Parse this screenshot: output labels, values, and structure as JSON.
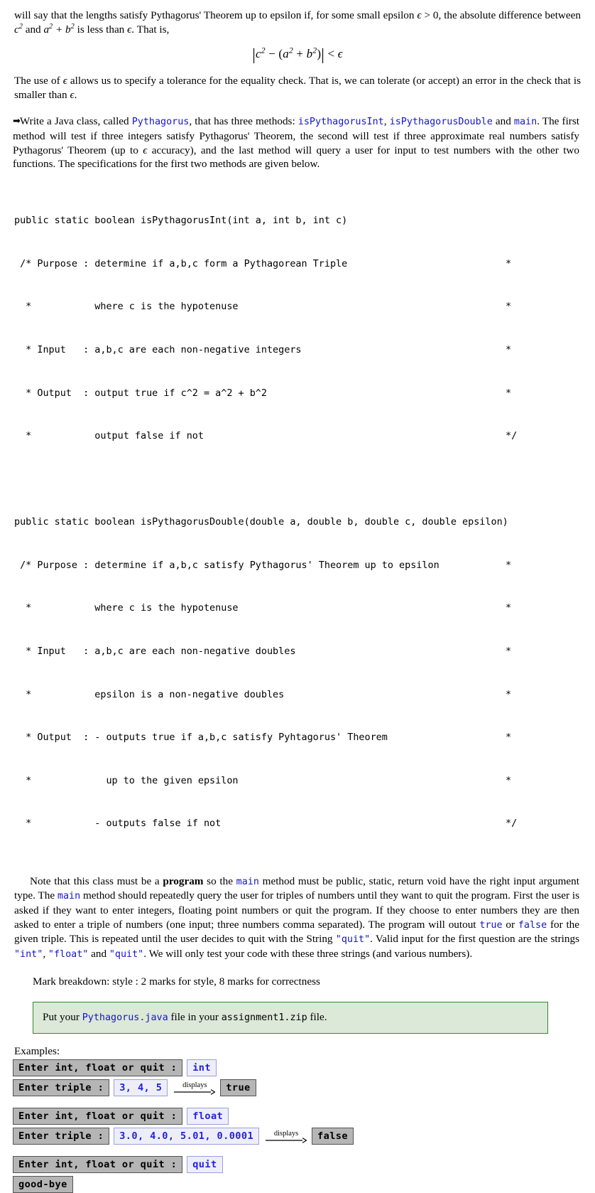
{
  "intro": {
    "para1_a": "will say that the lengths satisfy Pythagorus' Theorem ",
    "para1_em": "up to epsilon",
    "para1_b": " if, for some small epsilon ",
    "para1_eps_gt": " > 0, the absolute difference between ",
    "para1_c": " and ",
    "para1_d": " is less than ",
    "para1_e": ". That is,",
    "formula": "|c² − (a² + b²)| < ε",
    "formula_parts": {
      "bar_open": "|",
      "c": "c",
      "sup2_1": "2",
      "minus": "−",
      "paren_open": "(",
      "a": "a",
      "sup2_2": "2",
      "plus": "+",
      "b": "b",
      "sup2_3": "2",
      "paren_close": ")",
      "bar_close": "|",
      "lt": "<",
      "eps": "ε"
    },
    "para2_a": "The use of ",
    "para2_b": " allows us to specify a tolerance for the equality check. That is, we can tolerate (or accept) an error in the check that is smaller than ",
    "para2_c": "."
  },
  "task": {
    "bullet": "➡",
    "t1": "Write a Java class, called ",
    "class_name": "Pythagorus",
    "t2": ", that has three methods: ",
    "m1": "isPythagorusInt",
    "t3": ", ",
    "m2": "isPythagorusDouble",
    "t4": " and ",
    "m3": "main",
    "t5": ". The first method will test if three integers satisfy Pythagorus' Theorem, the second will test if three approximate real numbers satisfy Pythagorus' Theorem (up to ",
    "t6": " accuracy), and the last method will query a user for input to test numbers with the other two functions. The specifications for the first two methods are given below."
  },
  "spec_int": {
    "signature": "public static boolean isPythagorusInt(int a, int b, int c)",
    "lines": [
      {
        "text": " /* Purpose : determine if a,b,c form a Pythagorean Triple",
        "star": "*"
      },
      {
        "text": "  *           where c is the hypotenuse",
        "star": "*"
      },
      {
        "text": "  * Input   : a,b,c are each non-negative integers",
        "star": "*"
      },
      {
        "text": "  * Output  : output true if c^2 = a^2 + b^2",
        "star": "*"
      },
      {
        "text": "  *           output false if not",
        "star": "*/"
      }
    ]
  },
  "spec_double": {
    "signature": "public static boolean isPythagorusDouble(double a, double b, double c, double epsilon)",
    "lines": [
      {
        "text": " /* Purpose : determine if a,b,c satisfy Pythagorus' Theorem up to epsilon",
        "star": "*"
      },
      {
        "text": "  *           where c is the hypotenuse",
        "star": "*"
      },
      {
        "text": "  * Input   : a,b,c are each non-negative doubles",
        "star": "*"
      },
      {
        "text": "  *           epsilon is a non-negative doubles",
        "star": "*"
      },
      {
        "text": "  * Output  : - outputs true if a,b,c satisfy Pyhtagorus' Theorem",
        "star": "*"
      },
      {
        "text": "  *             up to the given epsilon",
        "star": "*"
      },
      {
        "text": "  *           - outputs false if not",
        "star": "*/"
      }
    ]
  },
  "note": {
    "n1": "Note that this class must be a ",
    "program": "program",
    "n2": " so the ",
    "main1": "main",
    "n3": " method must be public, static, return void have the right input argument type. The ",
    "main2": "main",
    "n4": " method should repeatedly query the user for triples of numbers until they want to quit the program. First the user is asked if they want to enter integers, floating point numbers or quit the program. If they choose to enter numbers they are then asked to enter a triple of numbers (one input; three numbers comma separated). The program will outout ",
    "true_kw": "true",
    "n5": " or ",
    "false_kw": "false",
    "n6": " for the given triple. This is repeated until the user decides to quit with the String ",
    "quit_str": "\"quit\"",
    "n7": ". Valid input for the first question are the strings ",
    "int_str": "\"int\"",
    "n8": ", ",
    "float_str": "\"float\"",
    "n9": " and ",
    "quit_str2": "\"quit\"",
    "n10": ". We will only test your code with these three strings (and various numbers)."
  },
  "marks": {
    "text": "Mark breakdown: style : 2 marks for style, 8 marks for correctness"
  },
  "submission": {
    "pre": "Put your ",
    "file": "Pythagorus.java",
    "mid": " file in your ",
    "zip": "assignment1.zip",
    "post": " file."
  },
  "examples": {
    "label": "Examples:",
    "displays_label": "displays",
    "groups": [
      {
        "rows": [
          {
            "prompt": "Enter int, float or quit :",
            "input": "int",
            "arrow": false,
            "output": null
          },
          {
            "prompt": "Enter triple :",
            "input": "3, 4, 5",
            "arrow": true,
            "output": "true"
          }
        ]
      },
      {
        "rows": [
          {
            "prompt": "Enter int, float or quit :",
            "input": "float",
            "arrow": false,
            "output": null
          },
          {
            "prompt": "Enter triple :",
            "input": "3.0, 4.0, 5.01, 0.0001",
            "arrow": true,
            "output": "false"
          }
        ]
      },
      {
        "rows": [
          {
            "prompt": "Enter int, float or quit :",
            "input": "quit",
            "arrow": false,
            "output": null
          },
          {
            "prompt": "good-bye",
            "input": null,
            "arrow": false,
            "output": null
          }
        ]
      }
    ]
  },
  "colors": {
    "code_blue": "#1414cc",
    "input_blue": "#2222dd",
    "box_gray": "#b5b5b5",
    "green_fill": "#dce8d8",
    "green_border": "#2f8a2f"
  }
}
